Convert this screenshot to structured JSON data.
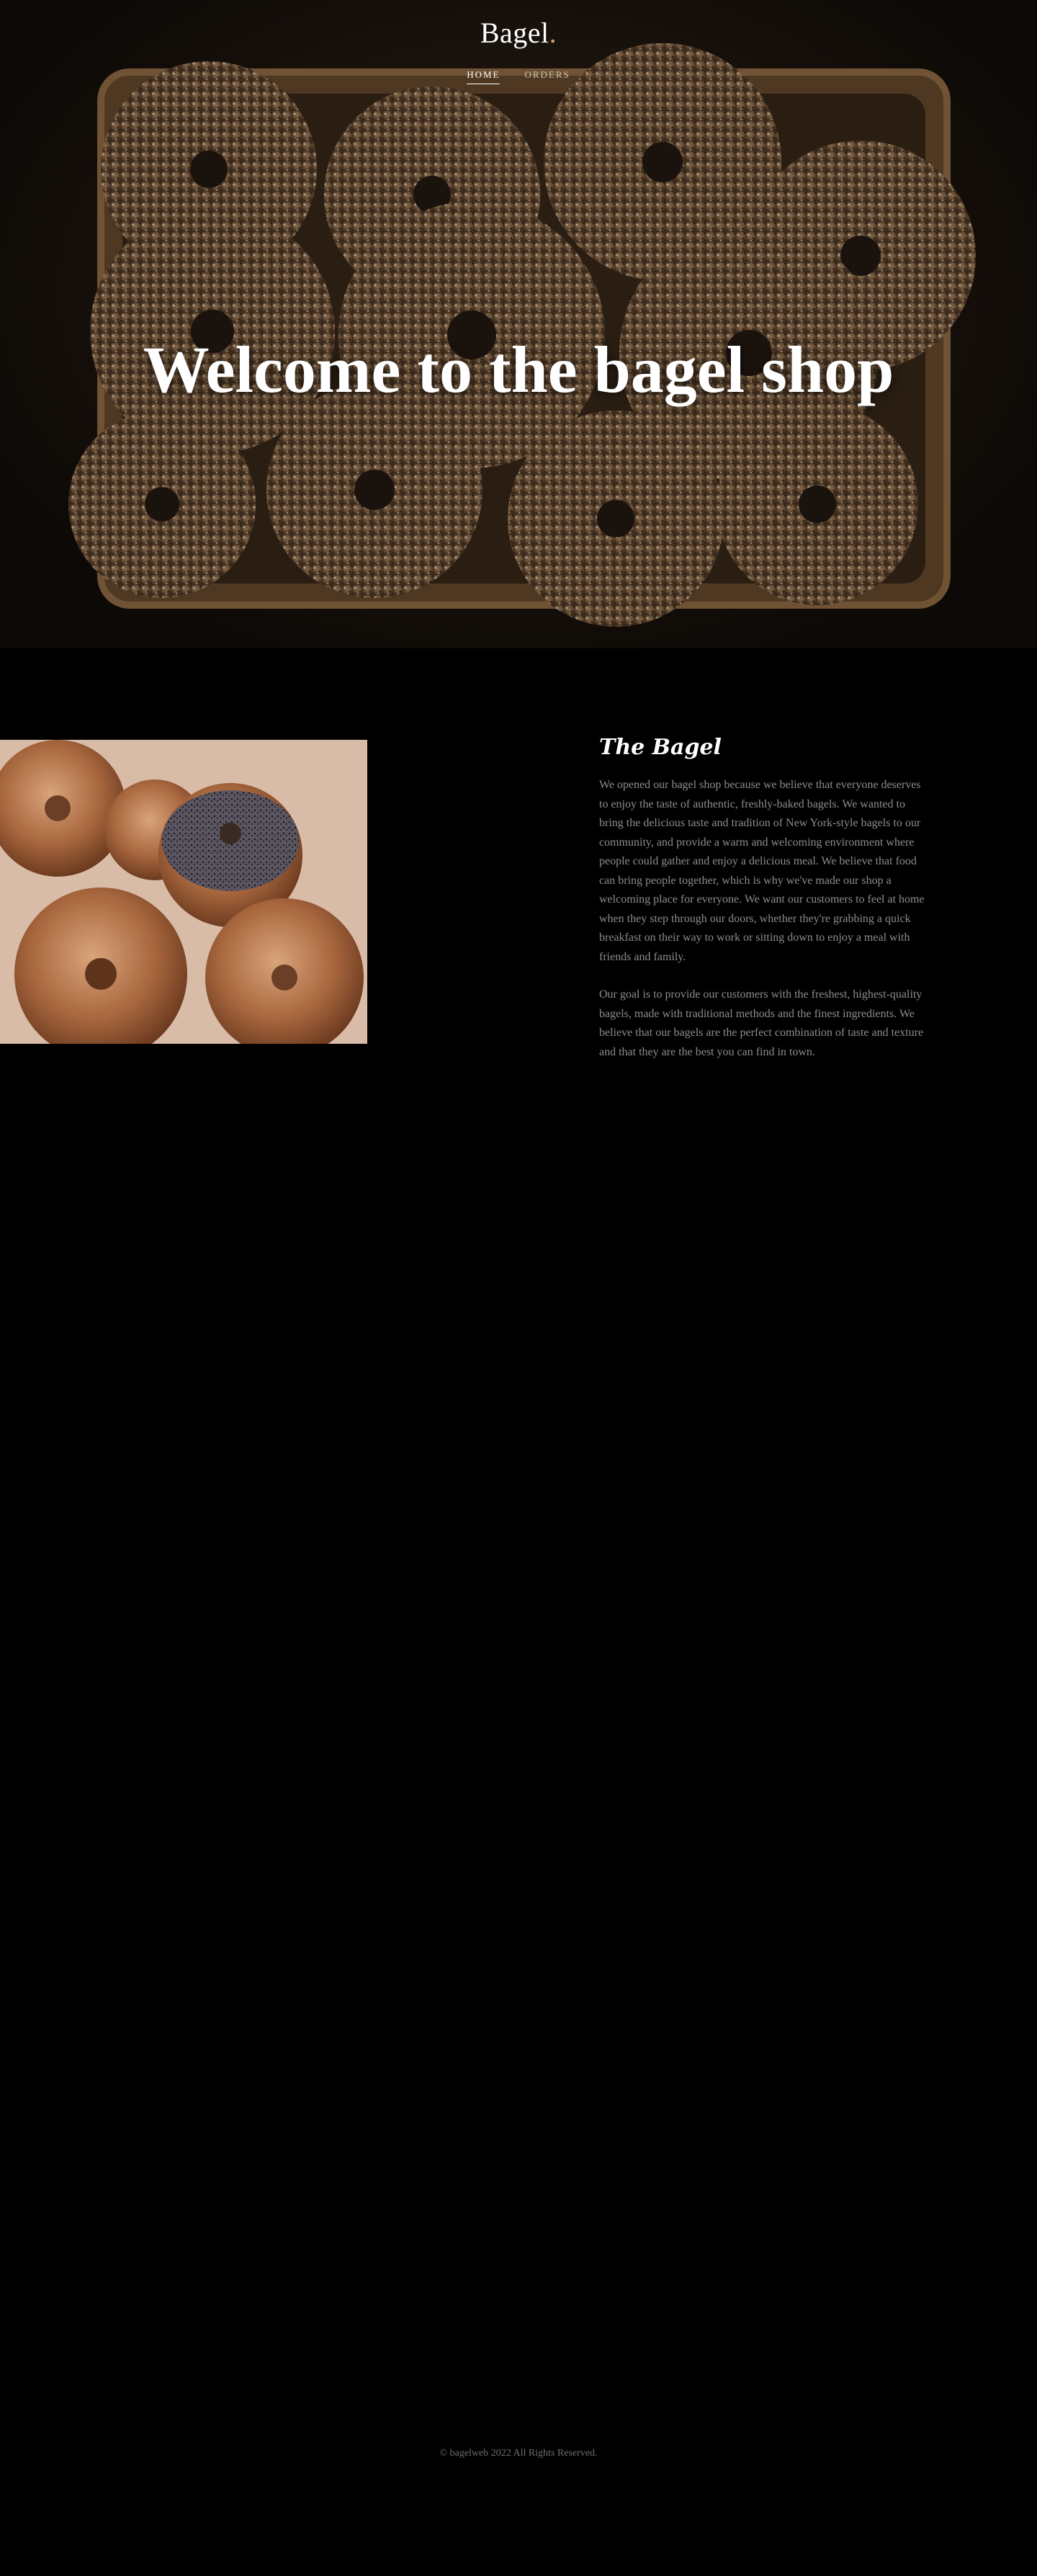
{
  "header": {
    "brand": "Bagel",
    "brand_dot": ".",
    "nav": [
      {
        "label": "HOME",
        "active": true
      },
      {
        "label": "ORDERS",
        "active": false
      }
    ]
  },
  "hero": {
    "title": "Welcome to the bagel shop",
    "image": "basket-of-sesame-bagels"
  },
  "about": {
    "image": "plate-of-assorted-bagels",
    "heading": "The Bagel",
    "paragraphs": [
      "We opened our bagel shop because we believe that everyone deserves to enjoy the taste of authentic, freshly-baked bagels. We wanted to bring the delicious taste and tradition of New York-style bagels to our community, and provide a warm and welcoming environment where people could gather and enjoy a delicious meal. We believe that food can bring people together, which is why we've made our shop a welcoming place for everyone. We want our customers to feel at home when they step through our doors, whether they're grabbing a quick breakfast on their way to work or sitting down to enjoy a meal with friends and family.",
      "Our goal is to provide our customers with the freshest, highest-quality bagels, made with traditional methods and the finest ingredients. We believe that our bagels are the perfect combination of taste and texture and that they are the best you can find in town."
    ]
  },
  "footer": {
    "copyright": "© bagelweb 2022 All Rights Reserved."
  },
  "colors": {
    "background": "#000000",
    "accent": "#c9a46a",
    "body_text": "#8d8d8d"
  }
}
